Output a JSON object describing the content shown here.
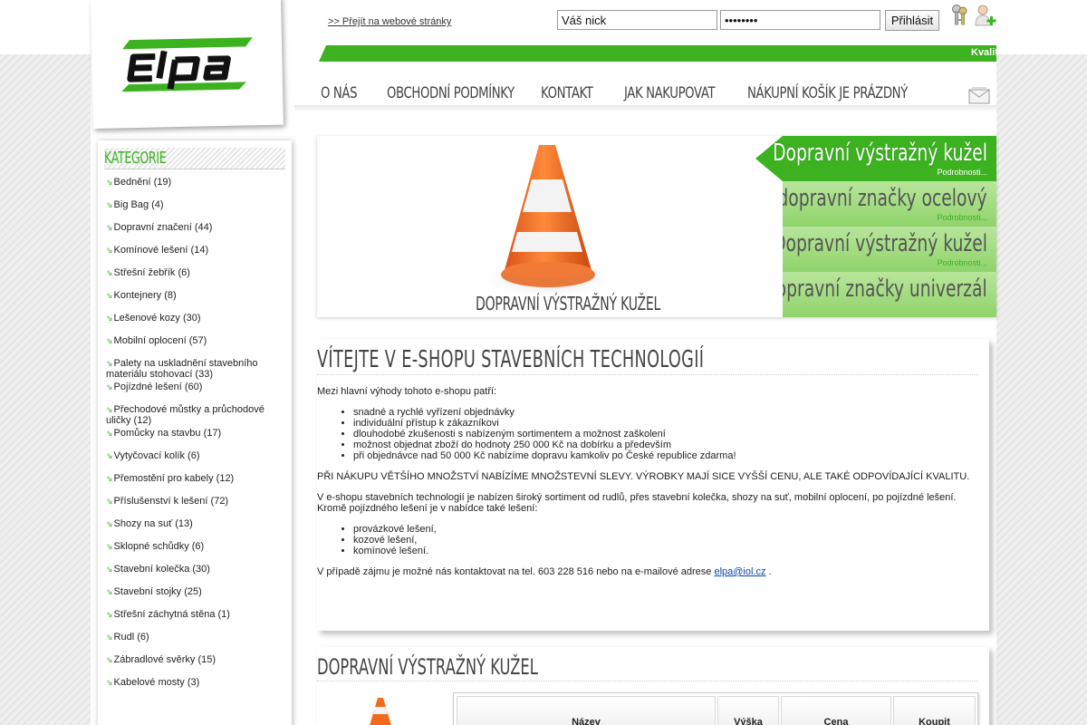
{
  "header": {
    "web_link": ">> Přejít na webové stránky",
    "nick_value": "Váš nick",
    "password_value": "••••••••",
    "login_label": "Přihlásit",
    "marquee": "Kvalit"
  },
  "menu": {
    "items": [
      "O NÁS",
      "OBCHODNÍ PODMÍNKY",
      "KONTAKT",
      "JAK NAKUPOVAT",
      "NÁKUPNÍ KOŠÍK JE PRÁZDNÝ"
    ]
  },
  "sidebar": {
    "heading": "KATEGORIE",
    "items": [
      "Bednění (19)",
      "Big Bag (4)",
      "Dopravní značení (44)",
      "Komínové lešení (14)",
      "Střešní žebřík (6)",
      "Kontejnery (8)",
      "Lešenové kozy (30)",
      "Mobilní oplocení (57)",
      "Palety na uskladnění stavebního materiálu stohovací (33)",
      "Pojízdné lešení (60)",
      "Přechodové můstky a průchodové uličky (12)",
      "Pomůcky na stavbu (17)",
      "Vytyčovací kolík (6)",
      "Přemostění pro kabely (12)",
      "Příslušenství k lešení (72)",
      "Shozy na suť (13)",
      "Sklopné schůdky (6)",
      "Stavební kolečka (30)",
      "Stavební stojky (25)",
      "Střešní záchytná stěna (1)",
      "Rudl (6)",
      "Zábradlové svěrky (15)",
      "Kabelové mosty (3)"
    ]
  },
  "slider": {
    "caption": "DOPRAVNÍ VÝSTRAŽNÝ KUŽEL",
    "tabs": [
      {
        "title": "Dopravní výstražný kužel",
        "detail": "Podrobnosti..."
      },
      {
        "title": "Úchyt pro dopravní značky ocelový",
        "detail": "Podrobnosti..."
      },
      {
        "title": "Dopravní výstražný kužel",
        "detail": "Podrobnosti..."
      },
      {
        "title": "Podstavec pro dopravní značky univerzál",
        "detail": ""
      }
    ]
  },
  "welcome": {
    "heading": "VÍTEJTE V E-SHOPU STAVEBNÍCH TECHNOLOGIÍ",
    "intro": "Mezi hlavní výhody tohoto e-shopu patří:",
    "benefits": [
      "snadné a rychlé vyřízení objednávky",
      "individuální přístup k zákazníkovi",
      "dlouhodobé zkušenosti s nabízeným sortimentem a možnost zaškolení",
      "možnost objednat zboží do hodnoty 250 000 Kč na dobírku a především",
      "při objednávce nad 50 000 Kč nabízíme dopravu kamkoliv po České republice zdarma!"
    ],
    "discount": "PŘI NÁKUPU VĚTŠÍHO MNOŽSTVÍ NABÍZÍME MNOŽSTEVNÍ SLEVY. VÝROBKY MAJÍ SICE VYŠŠÍ CENU, ALE TAKÉ ODPOVÍDAJÍCÍ KVALITU.",
    "range": "V e-shopu stavebních technologií je nabízen široký sortiment od rudlů, přes stavební kolečka, shozy na suť, mobilní oplocení, po pojízdné lešení. Kromě pojízdného lešení je v nabídce také lešení:",
    "scaffolds": [
      "provázkové lešení,",
      "kozové lešení,",
      "komínové lešení."
    ],
    "contact_text": "V případě zájmu je možné nás kontaktovat na tel. 603 228 516 nebo na e-mailové adrese",
    "email": "elpa@iol.cz",
    "contact_end": "."
  },
  "product": {
    "heading": "DOPRAVNÍ VÝSTRAŽNÝ KUŽEL",
    "columns": [
      "Název",
      "Výška",
      "Cena",
      "Koupit"
    ]
  },
  "colors": {
    "accent_green": "#3cb221",
    "cone_orange": "#f26a1b"
  }
}
